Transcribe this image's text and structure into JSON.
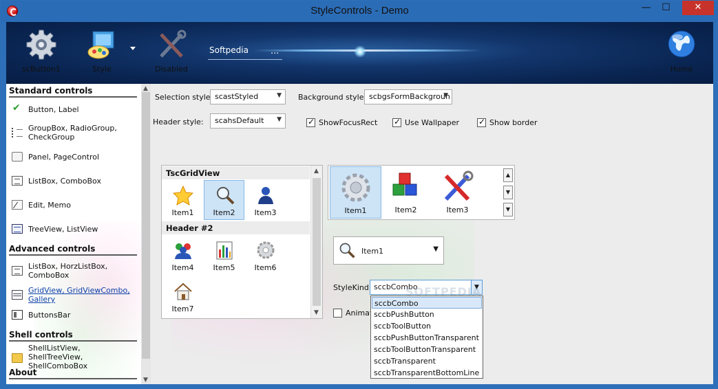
{
  "window": {
    "title": "StyleControls - Demo",
    "minimize": "—",
    "maximize": "☐",
    "close": "✕"
  },
  "toolbar": {
    "buttons": [
      {
        "label": "scButton1",
        "icon": "gear-icon"
      },
      {
        "label": "Style",
        "icon": "palette-icon"
      },
      {
        "label": "Disabled",
        "icon": "tools-icon",
        "disabled": true
      },
      {
        "label": "Home",
        "icon": "globe-icon"
      }
    ],
    "edit_text": "Softpedia",
    "edit_button": "..."
  },
  "sidebar": {
    "sections": [
      {
        "title": "Standard controls"
      },
      {
        "title": "Advanced controls"
      },
      {
        "title": "Shell controls"
      },
      {
        "title": "About"
      }
    ],
    "items": [
      {
        "label": "Button, Label"
      },
      {
        "label": "GroupBox, RadioGroup, CheckGroup"
      },
      {
        "label": "Panel, PageControl"
      },
      {
        "label": "ListBox, ComboBox"
      },
      {
        "label": "Edit, Memo"
      },
      {
        "label": "TreeView, ListView"
      },
      {
        "label": "ListBox, HorzListBox, ComboBox"
      },
      {
        "label": "GridView, GridViewCombo, Gallery",
        "selected": true
      },
      {
        "label": "ButtonsBar"
      },
      {
        "label": "ShellListView, ShellTreeView, ShellComboBox"
      }
    ]
  },
  "settings": {
    "selection_style_label": "Selection style:",
    "selection_style_value": "scastStyled",
    "background_style_label": "Background style:",
    "background_style_value": "scbgsFormBackgroun",
    "header_style_label": "Header style:",
    "header_style_value": "scahsDefault",
    "show_focus_rect": "ShowFocusRect",
    "use_wallpaper": "Use Wallpaper",
    "show_border": "Show border"
  },
  "gridview": {
    "header1": "TscGridView",
    "header2": "Header #2",
    "items": [
      "Item1",
      "Item2",
      "Item3",
      "Item4",
      "Item5",
      "Item6",
      "Item7"
    ]
  },
  "gallery": {
    "items": [
      "Item1",
      "Item2",
      "Item3"
    ]
  },
  "item_combo": {
    "value": "Item1"
  },
  "stylekind": {
    "label": "StyleKind:",
    "value": "sccbCombo",
    "options": [
      "sccbCombo",
      "sccbPushButton",
      "sccbToolButton",
      "sccbPushButtonTransparent",
      "sccbToolButtonTransparent",
      "sccbTransparent",
      "sccbTransparentBottomLine"
    ]
  },
  "animation_label": "Animatio",
  "watermark": "SOFTPEDIA",
  "colors": {
    "banner": "#0a2552",
    "selection": "#cde4f7",
    "titlebar": "#2b6cb6",
    "close": "#c7332a"
  }
}
